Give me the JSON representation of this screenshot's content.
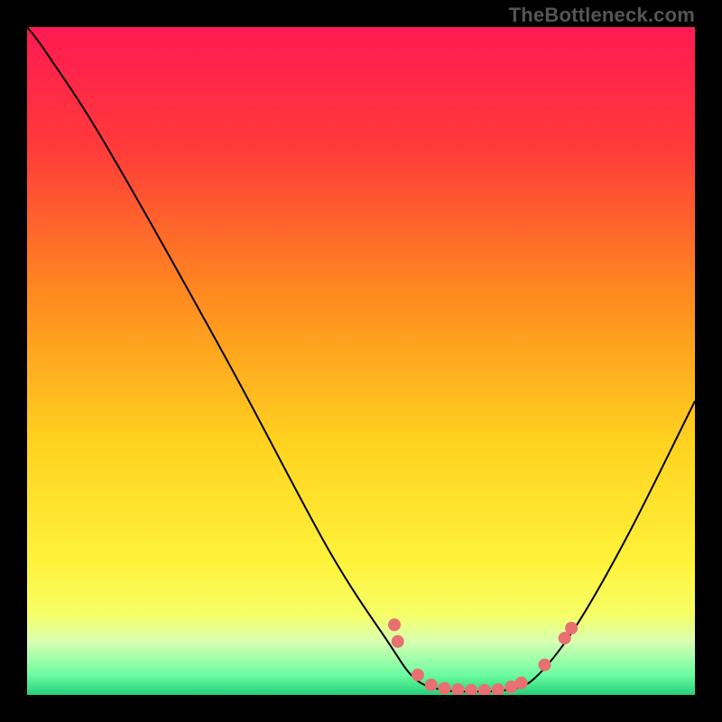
{
  "watermark": "TheBottleneck.com",
  "chart_data": {
    "type": "line",
    "title": "",
    "xlabel": "",
    "ylabel": "",
    "xlim": [
      0,
      100
    ],
    "ylim": [
      0,
      100
    ],
    "curve": [
      {
        "x": 0,
        "y": 100
      },
      {
        "x": 3,
        "y": 96
      },
      {
        "x": 12,
        "y": 82
      },
      {
        "x": 30,
        "y": 50
      },
      {
        "x": 45,
        "y": 22
      },
      {
        "x": 54,
        "y": 8
      },
      {
        "x": 58,
        "y": 2.5
      },
      {
        "x": 62,
        "y": 0.8
      },
      {
        "x": 67,
        "y": 0.5
      },
      {
        "x": 72,
        "y": 0.8
      },
      {
        "x": 76,
        "y": 2.5
      },
      {
        "x": 82,
        "y": 10
      },
      {
        "x": 90,
        "y": 24
      },
      {
        "x": 100,
        "y": 44
      }
    ],
    "dots": [
      {
        "x": 55.0,
        "y": 10.5
      },
      {
        "x": 55.5,
        "y": 8.0
      },
      {
        "x": 58.5,
        "y": 3.0
      },
      {
        "x": 60.5,
        "y": 1.5
      },
      {
        "x": 62.5,
        "y": 1.0
      },
      {
        "x": 64.5,
        "y": 0.8
      },
      {
        "x": 66.5,
        "y": 0.7
      },
      {
        "x": 68.5,
        "y": 0.7
      },
      {
        "x": 70.5,
        "y": 0.8
      },
      {
        "x": 72.5,
        "y": 1.2
      },
      {
        "x": 74.0,
        "y": 1.8
      },
      {
        "x": 77.5,
        "y": 4.5
      },
      {
        "x": 80.5,
        "y": 8.5
      },
      {
        "x": 81.5,
        "y": 10.0
      }
    ],
    "gradient_stops": [
      {
        "offset": 0.0,
        "color": "#ff1a53"
      },
      {
        "offset": 0.18,
        "color": "#ff3a3a"
      },
      {
        "offset": 0.4,
        "color": "#ff8a1f"
      },
      {
        "offset": 0.62,
        "color": "#ffd21f"
      },
      {
        "offset": 0.8,
        "color": "#fff23a"
      },
      {
        "offset": 0.88,
        "color": "#f6ff66"
      },
      {
        "offset": 0.92,
        "color": "#d8ffb3"
      },
      {
        "offset": 0.97,
        "color": "#6cfca1"
      },
      {
        "offset": 1.0,
        "color": "#25d07a"
      }
    ],
    "dot_color": "#e87070",
    "dot_radius": 7,
    "line_color": "#000000",
    "line_width": 2
  }
}
